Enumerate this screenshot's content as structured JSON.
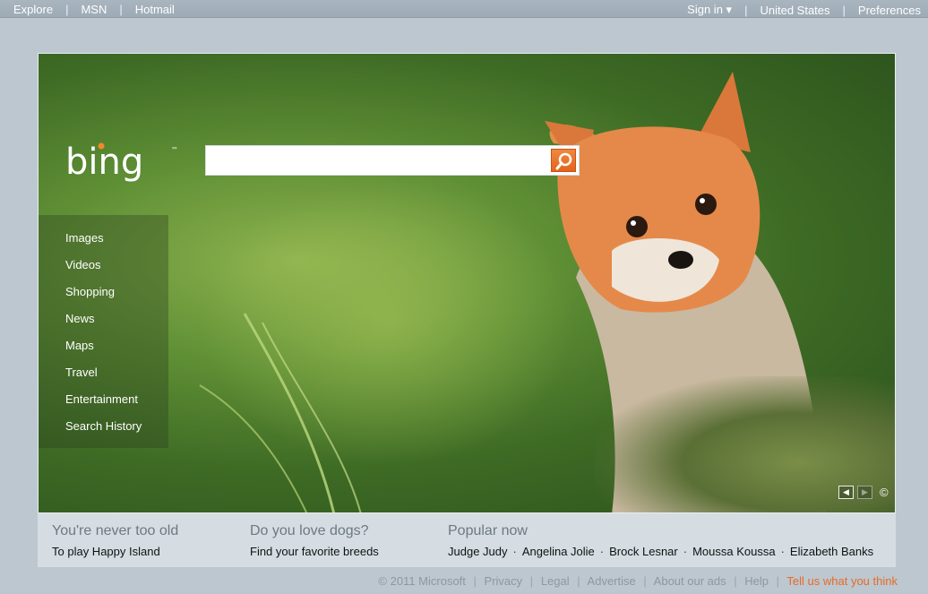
{
  "topbar": {
    "left": [
      "Explore",
      "MSN",
      "Hotmail"
    ],
    "signin": "Sign in",
    "signin_caret": "▾",
    "country": "United States",
    "preferences": "Preferences"
  },
  "logo": {
    "text": "bing",
    "tm": "™"
  },
  "search": {
    "value": "",
    "placeholder": ""
  },
  "nav": [
    "Images",
    "Videos",
    "Shopping",
    "News",
    "Maps",
    "Travel",
    "Entertainment",
    "Search History"
  ],
  "image_nav": {
    "prev": "◀",
    "next": "▶",
    "copyright": "©"
  },
  "info": {
    "col1": {
      "title": "You're never too old",
      "link": "To play Happy Island"
    },
    "col2": {
      "title": "Do you love dogs?",
      "link": "Find your favorite breeds"
    },
    "col3": {
      "title": "Popular now",
      "items": [
        "Judge Judy",
        "Angelina Jolie",
        "Brock Lesnar",
        "Moussa Koussa",
        "Elizabeth Banks"
      ]
    }
  },
  "footer": {
    "copyright": "© 2011 Microsoft",
    "links": [
      "Privacy",
      "Legal",
      "Advertise",
      "About our ads",
      "Help"
    ],
    "feedback": "Tell us what you think"
  },
  "colors": {
    "accent": "#e86a28",
    "search_button": "#e2641c",
    "page_bg": "#bcc7cf"
  }
}
